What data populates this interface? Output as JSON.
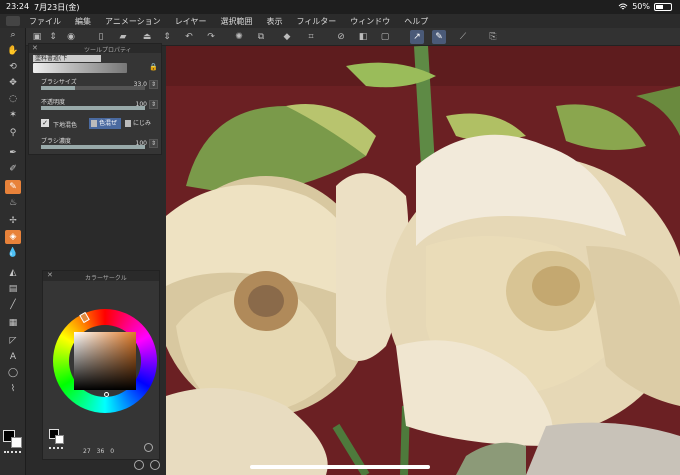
{
  "status": {
    "time": "23:24",
    "date": "7月23日(金)",
    "battery": "50%"
  },
  "menu": {
    "items": [
      "ファイル",
      "編集",
      "アニメーション",
      "レイヤー",
      "選択範囲",
      "表示",
      "フィルター",
      "ウィンドウ",
      "ヘルプ"
    ]
  },
  "tool_property": {
    "title": "ツールプロパティ",
    "brush_name": "塗料書道(下",
    "brush_size_label": "ブラシサイズ",
    "brush_size_value": "33.0",
    "brush_size_level": 0.33,
    "opacity_label": "不透明度",
    "opacity_value": "100",
    "opacity_level": 1.0,
    "blend_check_label": "下地混色",
    "blend_mode_1": "色混ぜ",
    "blend_mode_2": "にじみ",
    "density_label": "ブラシ濃度",
    "density_value": "100",
    "density_level": 1.0
  },
  "color_panel": {
    "title": "カラーサークル",
    "hue": "27",
    "saturation": "36",
    "value": "0"
  },
  "icons": {
    "main_color": "#000000",
    "sub_color": "#ffffff",
    "accent": "#e8823a"
  }
}
